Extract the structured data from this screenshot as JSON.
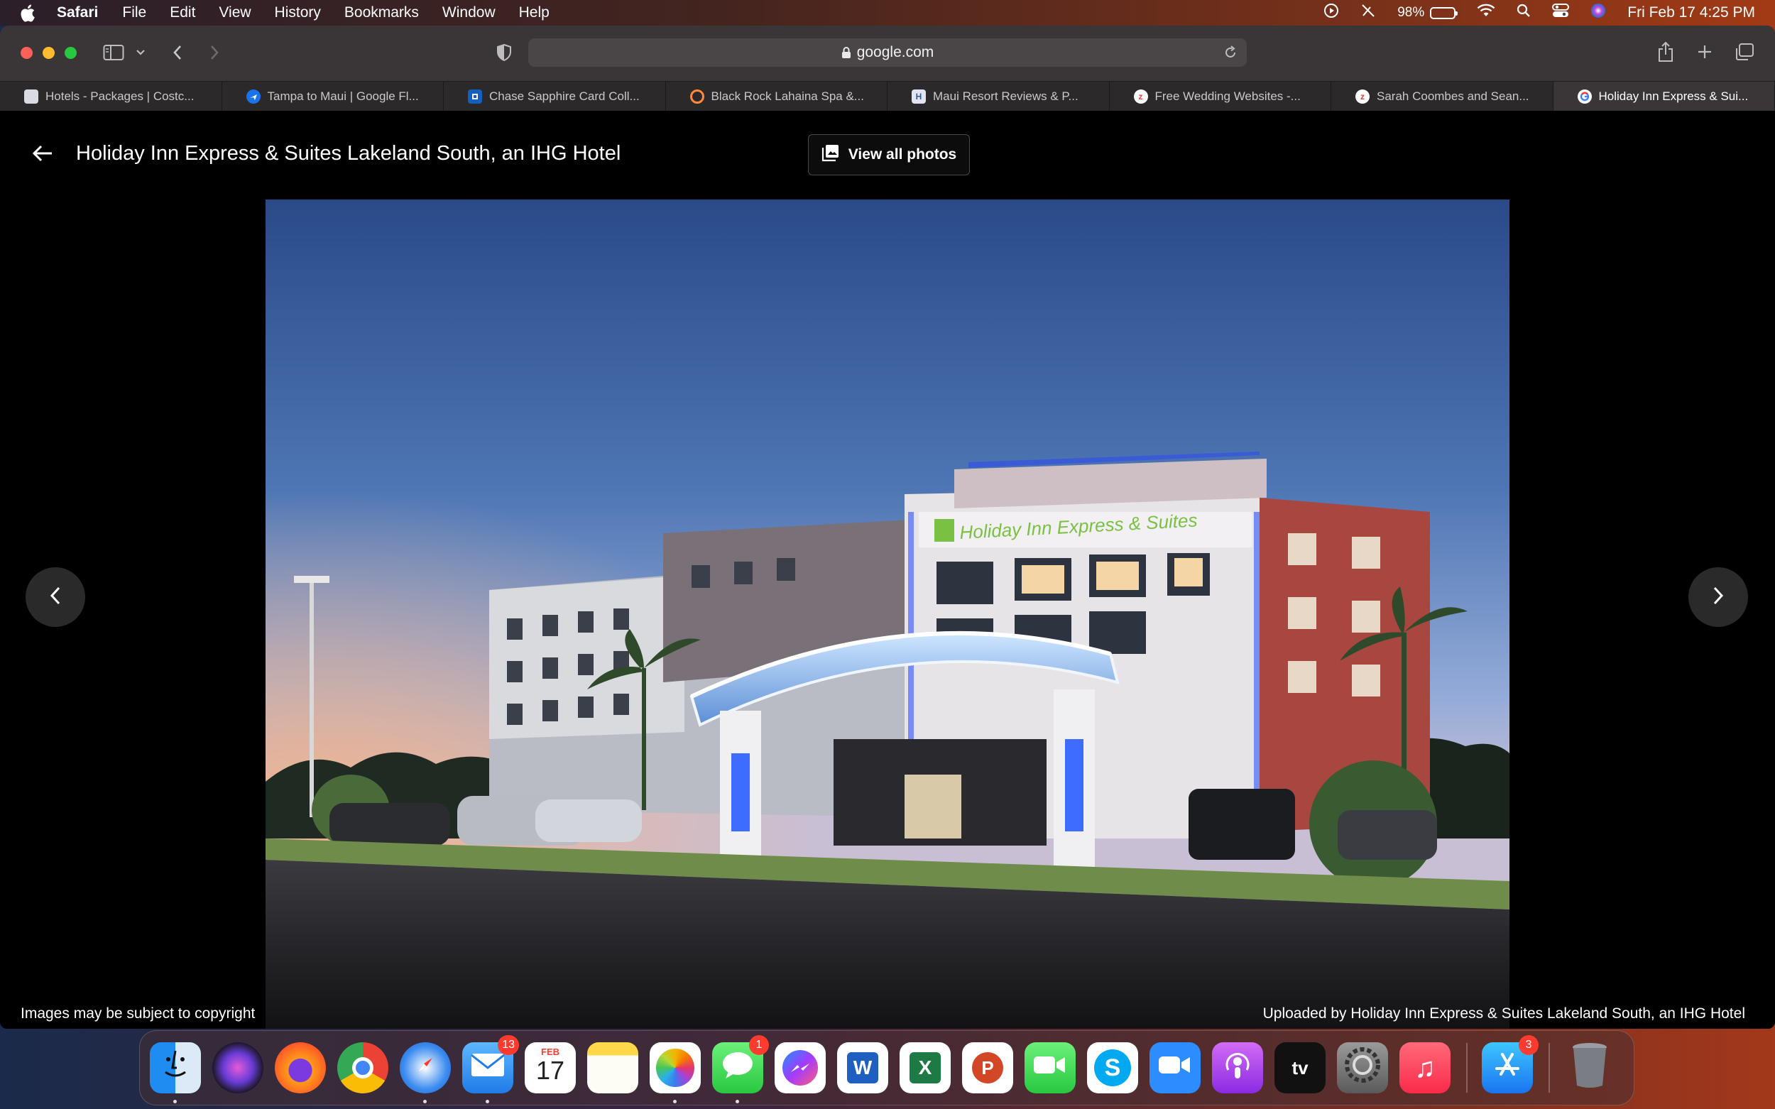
{
  "menubar": {
    "app": "Safari",
    "items": [
      "File",
      "Edit",
      "View",
      "History",
      "Bookmarks",
      "Window",
      "Help"
    ],
    "battery": "98%",
    "datetime": "Fri Feb 17  4:25 PM"
  },
  "toolbar": {
    "url": "google.com"
  },
  "tabs": [
    {
      "title": "Hotels - Packages | Costc...",
      "fav_color": "#d8dbe2"
    },
    {
      "title": "Tampa to Maui | Google Fl...",
      "fav_color": "#1a73e8"
    },
    {
      "title": "Chase Sapphire Card Coll...",
      "fav_color": "#1560bd"
    },
    {
      "title": "Black Rock Lahaina Spa &...",
      "fav_color": "#ff8a3d"
    },
    {
      "title": "Maui Resort Reviews & P...",
      "fav_color": "#3b5998"
    },
    {
      "title": "Free Wedding Websites -...",
      "fav_color": "#ffffff"
    },
    {
      "title": "Sarah Coombes and Sean...",
      "fav_color": "#ffffff"
    },
    {
      "title": "Holiday Inn Express & Sui...",
      "fav_color": "#ffffff"
    }
  ],
  "page": {
    "title": "Holiday Inn Express & Suites Lakeland South, an IHG Hotel",
    "view_all_label": "View all photos",
    "sign_text": "Holiday Inn Express & Suites",
    "copyright": "Images may be subject to copyright",
    "uploaded_by": "Uploaded by Holiday Inn Express & Suites Lakeland South, an IHG Hotel"
  },
  "dock": {
    "apps": [
      {
        "name": "Finder",
        "icon": "finder-icon",
        "running": true
      },
      {
        "name": "Siri",
        "icon": "siri-icon"
      },
      {
        "name": "Firefox",
        "icon": "firefox-icon"
      },
      {
        "name": "Chrome",
        "icon": "chrome-icon"
      },
      {
        "name": "Safari",
        "icon": "safari-icon",
        "running": true
      },
      {
        "name": "Mail",
        "icon": "mail-icon",
        "badge": "13",
        "running": true
      },
      {
        "name": "Calendar",
        "icon": "calendar-icon",
        "month": "FEB",
        "day": "17"
      },
      {
        "name": "Notes",
        "icon": "notes-icon"
      },
      {
        "name": "Photos",
        "icon": "photos-icon",
        "running": true
      },
      {
        "name": "Messages",
        "icon": "messages-icon",
        "badge": "1",
        "running": true
      },
      {
        "name": "Messenger",
        "icon": "messenger-icon"
      },
      {
        "name": "Word",
        "icon": "word-icon",
        "glyph": "W"
      },
      {
        "name": "Excel",
        "icon": "excel-icon",
        "glyph": "X"
      },
      {
        "name": "PowerPoint",
        "icon": "powerpoint-icon",
        "glyph": "P"
      },
      {
        "name": "FaceTime",
        "icon": "facetime-icon"
      },
      {
        "name": "Skype",
        "icon": "skype-icon",
        "glyph": "S"
      },
      {
        "name": "Zoom",
        "icon": "zoom-icon"
      },
      {
        "name": "Podcasts",
        "icon": "podcasts-icon"
      },
      {
        "name": "Apple TV",
        "icon": "appletv-icon",
        "glyph": "tv"
      },
      {
        "name": "System Settings",
        "icon": "settings-icon"
      },
      {
        "name": "Music",
        "icon": "music-icon",
        "glyph": "♫"
      },
      {
        "name": "App Store",
        "icon": "appstore-icon",
        "badge": "3"
      },
      {
        "name": "Trash",
        "icon": "trash-icon"
      }
    ]
  }
}
